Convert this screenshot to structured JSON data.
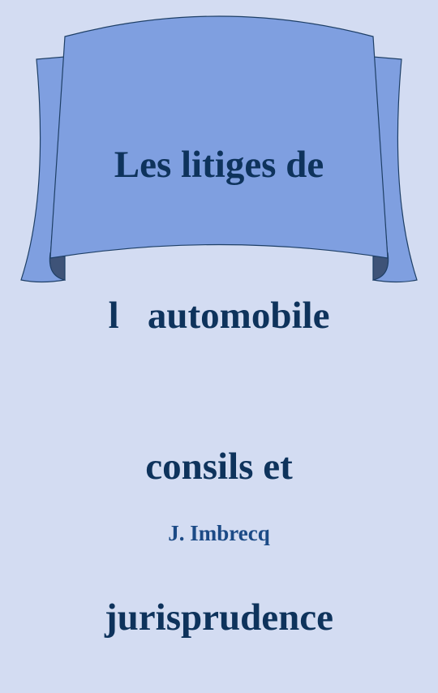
{
  "cover": {
    "title_lines": [
      "Les litiges de",
      "l   automobile",
      "consils et",
      "jurisprudence"
    ],
    "author": "J. Imbrecq"
  },
  "colors": {
    "background": "#d3dcf2",
    "banner": "#7f9fe0",
    "banner_fold": "#3e5378",
    "title": "#0e335c",
    "author": "#1b4a86"
  }
}
